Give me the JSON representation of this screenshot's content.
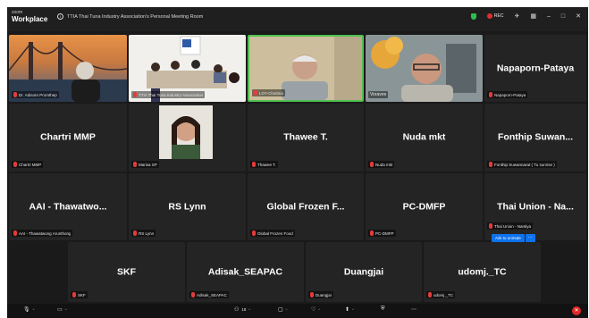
{
  "app": {
    "brand_top": "zoom",
    "brand_bottom": "Workplace",
    "meeting_title": "TTIA Thai Tuna Industry Association's Personal Meeting Room",
    "rec_label": "REC"
  },
  "tiles": {
    "t1": {
      "label": "Dr. Adisorn Promthep"
    },
    "t2": {
      "label": "TTIA Thai Tuna Industry Association"
    },
    "t3": {
      "label": "LOY-Chutima"
    },
    "t4": {
      "label": "Voravee"
    },
    "t5": {
      "name": "Napaporn-Pataya",
      "label": "Napaporn-Pataya"
    },
    "t6": {
      "name": "Chartri MMP",
      "label": "Chartri MMP"
    },
    "t7": {
      "label": "Marisa SP"
    },
    "t8": {
      "name": "Thawee T.",
      "label": "Thawee T."
    },
    "t9": {
      "name": "Nuda mkt",
      "label": "Nuda mkt"
    },
    "t10": {
      "name": "Fonthip Suwan...",
      "label": "Fonthip Suwannarat ( Tu sunrise )"
    },
    "t11": {
      "name": "AAI - Thawatwo...",
      "label": "AAI - Thawatwong Arunthong"
    },
    "t12": {
      "name": "RS Lynn",
      "label": "RS Lynn"
    },
    "t13": {
      "name": "Global Frozen F...",
      "label": "Global Frozen Food"
    },
    "t14": {
      "name": "PC-DMFP",
      "label": "PC-DMFP"
    },
    "t15": {
      "name": "Thai Union - Na...",
      "label": "Thai Union - Nantiya"
    },
    "t16": {
      "name": "SKF",
      "label": "SKF"
    },
    "t17": {
      "name": "Adisak_SEAPAC",
      "label": "Adisak_SEAPAC"
    },
    "t18": {
      "name": "Duangjai",
      "label": "Duangjai"
    },
    "t19": {
      "name": "udomj._TC",
      "label": "udomj._TC"
    }
  },
  "ask_to_unmute": "Ask to unmute",
  "toolbar": {
    "participants_count": "18"
  }
}
